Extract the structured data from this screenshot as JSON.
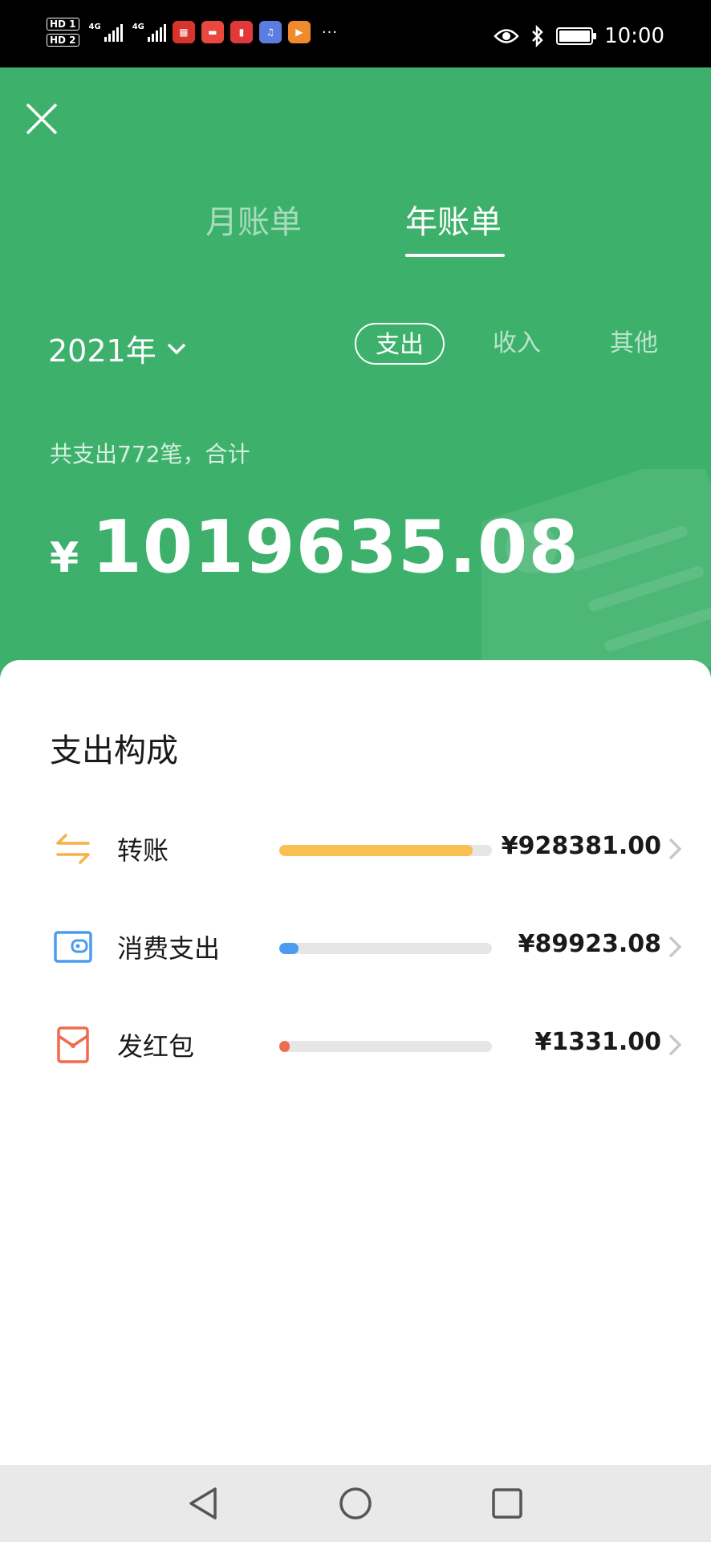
{
  "status_bar": {
    "hd1": "HD 1",
    "hd2": "HD 2",
    "net1": "4G",
    "net2": "4G",
    "dots": "···",
    "time": "10:00"
  },
  "header": {
    "tabs": [
      {
        "label": "月账单",
        "active": false
      },
      {
        "label": "年账单",
        "active": true
      }
    ],
    "year": "2021年",
    "filters": [
      {
        "label": "支出",
        "active": true
      },
      {
        "label": "收入",
        "active": false
      },
      {
        "label": "其他",
        "active": false
      }
    ],
    "summary": "共支出772笔，合计",
    "currency": "¥",
    "total": "1019635.08"
  },
  "composition": {
    "title": "支出构成",
    "items": [
      {
        "label": "转账",
        "amount": "¥928381.00",
        "fraction": 0.91,
        "color": "#f9c153",
        "icon": "transfer-icon"
      },
      {
        "label": "消费支出",
        "amount": "¥89923.08",
        "fraction": 0.09,
        "color": "#4b9cf0",
        "icon": "wallet-icon"
      },
      {
        "label": "发红包",
        "amount": "¥1331.00",
        "fraction": 0.01,
        "color": "#f06a4d",
        "icon": "red-envelope-icon"
      }
    ]
  },
  "colors": {
    "brand_green": "#3db16b"
  }
}
